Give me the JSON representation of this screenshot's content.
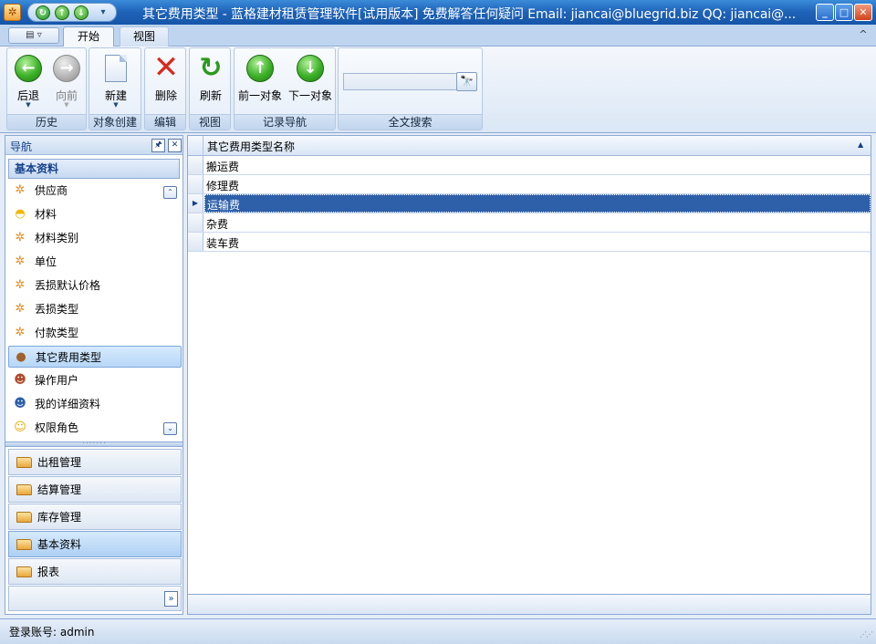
{
  "window": {
    "title": "其它费用类型 - 蓝格建材租赁管理软件[试用版本] 免费解答任何疑问 Email: jiancai@bluegrid.biz QQ: jiancai@...",
    "min": "_",
    "max": "□",
    "close": "✕"
  },
  "qat": {
    "refresh": "↻",
    "back": "↑",
    "fwd": "↓",
    "more": "▾"
  },
  "ribbon": {
    "app_menu": "▤ ▿",
    "tabs": [
      {
        "label": "开始"
      },
      {
        "label": "视图"
      }
    ],
    "collapse": "^",
    "groups": {
      "history": {
        "caption": "历史",
        "back": "后退",
        "forward": "向前"
      },
      "create": {
        "caption": "对象创建",
        "new": "新建"
      },
      "edit": {
        "caption": "编辑",
        "delete": "删除"
      },
      "view": {
        "caption": "视图",
        "refresh": "刷新"
      },
      "record_nav": {
        "caption": "记录导航",
        "prev": "前一对象",
        "next": "下一对象"
      },
      "search": {
        "caption": "全文搜索",
        "value": "",
        "button": "🔭"
      }
    }
  },
  "nav": {
    "title": "导航",
    "pin": "🖈",
    "close": "✕",
    "group_title": "基本资料",
    "items": [
      {
        "label": "供应商",
        "icon": "gear-icon"
      },
      {
        "label": "材料",
        "icon": "helmet-icon"
      },
      {
        "label": "材料类别",
        "icon": "gear-icon"
      },
      {
        "label": "单位",
        "icon": "gear-icon"
      },
      {
        "label": "丢损默认价格",
        "icon": "gear-icon"
      },
      {
        "label": "丢损类型",
        "icon": "gear-icon"
      },
      {
        "label": "付款类型",
        "icon": "gear-icon"
      },
      {
        "label": "其它费用类型",
        "icon": "money-bag-icon"
      },
      {
        "label": "操作用户",
        "icon": "user-icon"
      },
      {
        "label": "我的详细资料",
        "icon": "user-info-icon"
      },
      {
        "label": "权限角色",
        "icon": "mask-icon"
      }
    ],
    "scroll_up": "⌃",
    "scroll_down": "⌄",
    "splitter": "· · · · · · ·",
    "groups": [
      {
        "label": "出租管理"
      },
      {
        "label": "结算管理"
      },
      {
        "label": "库存管理"
      },
      {
        "label": "基本资料"
      },
      {
        "label": "报表"
      }
    ],
    "overflow": "»"
  },
  "grid": {
    "column": "其它费用类型名称",
    "sort": "▲",
    "rows": [
      {
        "name": "搬运费"
      },
      {
        "name": "修理费"
      },
      {
        "name": "运输费"
      },
      {
        "name": "杂费"
      },
      {
        "name": "装车费"
      }
    ],
    "selected_marker": "▶"
  },
  "status": {
    "login": "登录账号: admin"
  }
}
